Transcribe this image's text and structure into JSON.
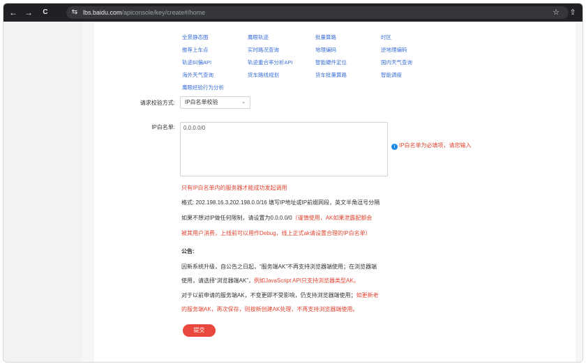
{
  "browser": {
    "url_host": "lbs.baidu.com",
    "url_path": "/apiconsole/key/create#/home",
    "back_icon": "←",
    "forward_icon": "→",
    "reload_icon": "C",
    "tune_icon": "⇆",
    "star_icon": "☆",
    "extension_icon": "⇧"
  },
  "services": [
    [
      "全景静态图",
      "鹰眼轨迹",
      "批量算路",
      "时区"
    ],
    [
      "推荐上车点",
      "实时路况查询",
      "地理编码",
      "逆地理编码"
    ],
    [
      "轨迹纠偏API",
      "轨迹重合率分析API",
      "智能硬件定位",
      "国内天气查询"
    ],
    [
      "海外天气查询",
      "货车路线规划",
      "货车批量算路",
      "智能调度"
    ],
    [
      "鹰眼经验行为分析"
    ]
  ],
  "form": {
    "verify_label": "请求校验方式:",
    "verify_value": "IP白名单校验",
    "verify_chevron": "⌄",
    "whitelist_label": "IP白名单:",
    "whitelist_value": "0.0.0.0/0",
    "hint_icon": "i",
    "required_hint": "IP白名单为必填项，请您输入",
    "only_whitelisted": "只有IP白名单内的服务器才能成功发起调用",
    "format_text": "格式: 202.198.16.3,202.198.0.0/16 填写IP地址或IP前缀网段，英文半角逗号分隔",
    "norestrict_text": "如果不想对IP做任何限制，请设置为0.0.0.0/0",
    "norestrict_warn": "（谨慎使用，AK如果泄露配额会",
    "norestrict_warn2": "被其用户消费，上线前可以用作Debug，线上正式ak请设置合理的IP白名单）"
  },
  "notice": {
    "title": "公告:",
    "line1": "因新系统升级，自公告之日起，“服务端AK”不再支持浏览器端使用；在浏览器端",
    "line2_a": "使用，请选择“浏览器端AK”，",
    "line2_b": "例如JavaScript API只支持浏览器类型AK。",
    "line3_a": "对于以前申请的服务端AK，不变更即不受影响，仍支持浏览器端使用；",
    "line3_b": "如更新老",
    "line4": "的服务端AK，再次保存，则按新创建AK处理，不再支持浏览器端使用。"
  },
  "submit_label": "提交",
  "colors": {
    "accent": "#e8483d",
    "link": "#3b6fd8",
    "warn": "#e1432f"
  }
}
